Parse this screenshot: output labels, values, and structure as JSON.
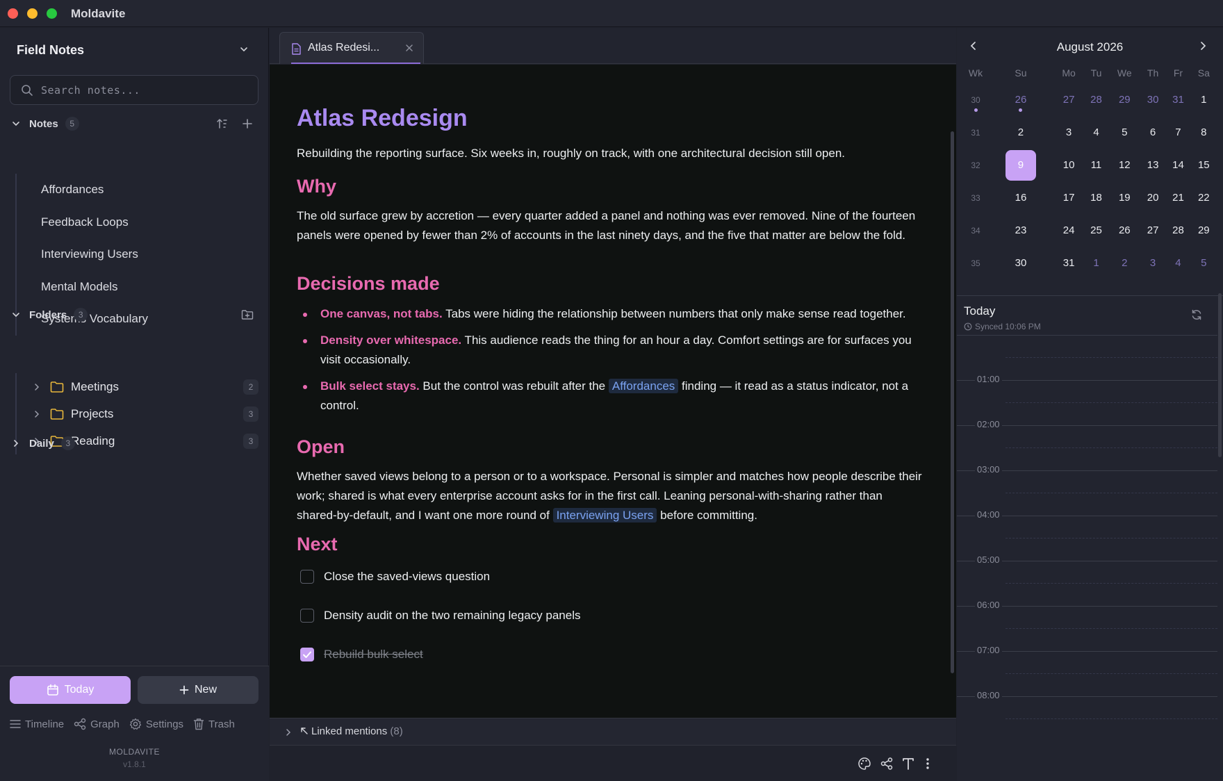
{
  "window": {
    "title": "Moldavite"
  },
  "sidebar": {
    "vault_name": "Field Notes",
    "search_placeholder": "Search notes...",
    "notes_section": {
      "label": "Notes",
      "count": "5",
      "items": [
        "Affordances",
        "Feedback Loops",
        "Interviewing Users",
        "Mental Models",
        "Systems Vocabulary"
      ]
    },
    "folders_section": {
      "label": "Folders",
      "count": "3",
      "items": [
        {
          "name": "Meetings",
          "count": "2"
        },
        {
          "name": "Projects",
          "count": "3"
        },
        {
          "name": "Reading",
          "count": "3"
        }
      ]
    },
    "daily_section": {
      "label": "Daily",
      "count": "3"
    },
    "today_button": "Today",
    "new_button": "New",
    "nav": {
      "timeline": "Timeline",
      "graph": "Graph",
      "settings": "Settings",
      "trash": "Trash"
    },
    "brand": "MOLDAVITE",
    "version": "v1.8.1"
  },
  "tab": {
    "label": "Atlas Redesi..."
  },
  "doc": {
    "title": "Atlas Redesign",
    "intro": "Rebuilding the reporting surface. Six weeks in, roughly on track, with one architectural decision still open.",
    "why_heading": "Why",
    "why_text": "The old surface grew by accretion — every quarter added a panel and nothing was ever removed. Nine of the fourteen panels were opened by fewer than 2% of accounts in the last ninety days, and the five that matter are below the fold.",
    "decisions_heading": "Decisions made",
    "decisions": [
      {
        "strong": "One canvas, not tabs.",
        "text": " Tabs were hiding the relationship between numbers that only make sense read together."
      },
      {
        "strong": "Density over whitespace.",
        "text": " This audience reads the thing for an hour a day. Comfort settings are for surfaces you visit occasionally."
      },
      {
        "strong": "Bulk select stays.",
        "pre": " But the control was rebuilt after the ",
        "link": "Affordances",
        "post": " finding — it read as a status indicator, not a control."
      }
    ],
    "open_heading": "Open",
    "open_pre": "Whether saved views belong to a person or to a workspace. Personal is simpler and matches how people describe their work; shared is what every enterprise account asks for in the first call. Leaning personal-with-sharing rather than shared-by-default, and I want one more round of ",
    "open_link": "Interviewing Users",
    "open_post": " before committing.",
    "next_heading": "Next",
    "todos": [
      {
        "text": "Close the saved-views question",
        "done": false
      },
      {
        "text": "Density audit on the two remaining legacy panels",
        "done": false
      },
      {
        "text": "Rebuild bulk select",
        "done": true
      }
    ]
  },
  "backlinks": {
    "label": "Linked mentions",
    "count": "(8)"
  },
  "calendar": {
    "month_label": "August 2026",
    "weekday_headers": [
      "Wk",
      "Su",
      "Mo",
      "Tu",
      "We",
      "Th",
      "Fr",
      "Sa"
    ],
    "weeks": [
      {
        "wk": "30",
        "days": [
          "26",
          "27",
          "28",
          "29",
          "30",
          "31",
          "1"
        ]
      },
      {
        "wk": "31",
        "days": [
          "2",
          "3",
          "4",
          "5",
          "6",
          "7",
          "8"
        ]
      },
      {
        "wk": "32",
        "days": [
          "9",
          "10",
          "11",
          "12",
          "13",
          "14",
          "15"
        ]
      },
      {
        "wk": "33",
        "days": [
          "16",
          "17",
          "18",
          "19",
          "20",
          "21",
          "22"
        ]
      },
      {
        "wk": "34",
        "days": [
          "23",
          "24",
          "25",
          "26",
          "27",
          "28",
          "29"
        ]
      },
      {
        "wk": "35",
        "days": [
          "30",
          "31",
          "1",
          "2",
          "3",
          "4",
          "5"
        ]
      }
    ],
    "selected_day": "9"
  },
  "today_panel": {
    "title": "Today",
    "synced": "Synced 10:06 PM",
    "hours": [
      "01:00",
      "02:00",
      "03:00",
      "04:00",
      "05:00",
      "06:00",
      "07:00",
      "08:00"
    ]
  },
  "colors": {
    "accent": "#c8a2f5",
    "title": "#a98af0",
    "heading": "#e86ab0",
    "link": "#7aa2f0"
  }
}
